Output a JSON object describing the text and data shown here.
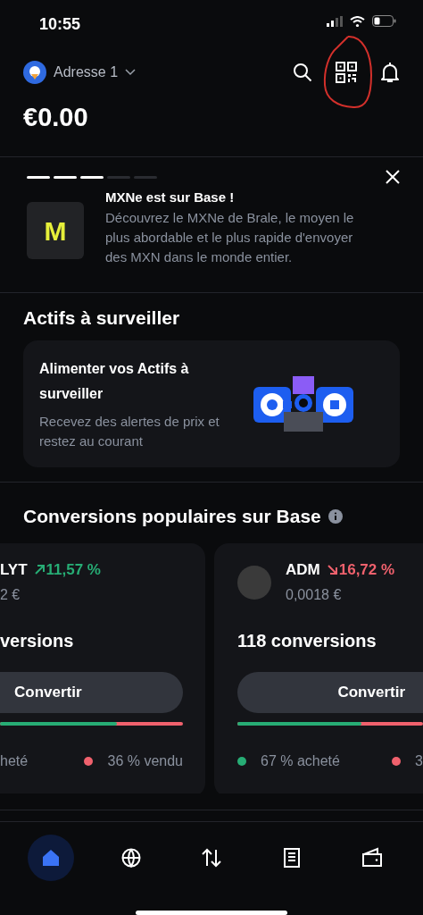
{
  "status_bar": {
    "time": "10:55"
  },
  "header": {
    "account": "Adresse 1",
    "balance": "€0.00"
  },
  "banner": {
    "progress": [
      {
        "viewed": true
      },
      {
        "viewed": true
      },
      {
        "viewed": true
      },
      {
        "viewed": false
      },
      {
        "viewed": false
      }
    ],
    "logo_letter": "M",
    "title": "MXNe est sur Base !",
    "text": "Découvrez le MXNe de Brale, le moyen le plus abordable et le plus rapide d'envoyer des MXN dans le monde entier."
  },
  "watchlist": {
    "heading": "Actifs à surveiller",
    "card_title": "Alimenter vos Actifs à surveiller",
    "card_text": "Recevez des alertes de prix et restez au courant"
  },
  "conversions": {
    "heading": "Conversions populaires sur Base",
    "cards": [
      {
        "symbol": "LYT",
        "rising": true,
        "change": "11,57 %",
        "price": "2 €",
        "count": "versions",
        "button": "Convertir",
        "level": 0.64,
        "bought": "heté",
        "sold": "36 % vendu",
        "avatar": false
      },
      {
        "symbol": "ADM",
        "rising": false,
        "change": "16,72 %",
        "price": "0,0018 €",
        "count": "118 conversions",
        "button": "Convertir",
        "level": 0.67,
        "bought": "67 % acheté",
        "sold": "3",
        "avatar": true
      }
    ]
  },
  "nav": [
    {
      "kind": "home",
      "selected": true
    },
    {
      "kind": "globe",
      "selected": false
    },
    {
      "kind": "swap",
      "selected": false
    },
    {
      "kind": "document",
      "selected": false
    },
    {
      "kind": "wallet",
      "selected": false
    }
  ]
}
